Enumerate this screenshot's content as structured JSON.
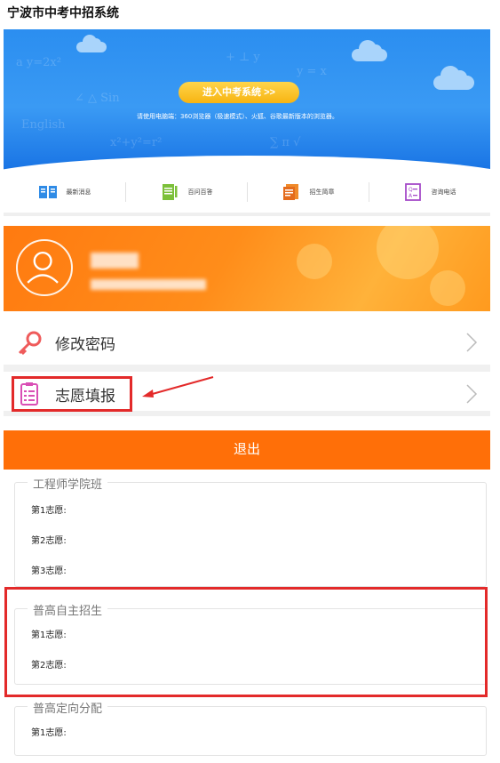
{
  "app": {
    "title": "宁波市中考中招系统"
  },
  "banner": {
    "enter_button": "进入中考系统 >>",
    "tip": "请使用电脑端：360浏览器（极速模式）、火狐、谷歌最新版本的浏览器。"
  },
  "quick_nav": [
    {
      "label": "最新消息",
      "icon": "news-icon"
    },
    {
      "label": "百问百答",
      "icon": "qa-notebook-icon"
    },
    {
      "label": "招生简章",
      "icon": "brochure-icon"
    },
    {
      "label": "咨询电话",
      "icon": "consult-phone-icon"
    }
  ],
  "menu": {
    "change_password": "修改密码",
    "fill_volunteer": "志愿填报"
  },
  "logout_label": "退出",
  "sections": [
    {
      "title": "工程师学院班",
      "choices": [
        "第1志愿:",
        "第2志愿:",
        "第3志愿:"
      ]
    },
    {
      "title": "普高自主招生",
      "choices": [
        "第1志愿:",
        "第2志愿:"
      ]
    },
    {
      "title": "普高定向分配",
      "choices": [
        "第1志愿:"
      ]
    }
  ],
  "colors": {
    "accent_orange": "#ff6f08",
    "banner_blue": "#2b8ef0",
    "annotation_red": "#e32a2a"
  }
}
